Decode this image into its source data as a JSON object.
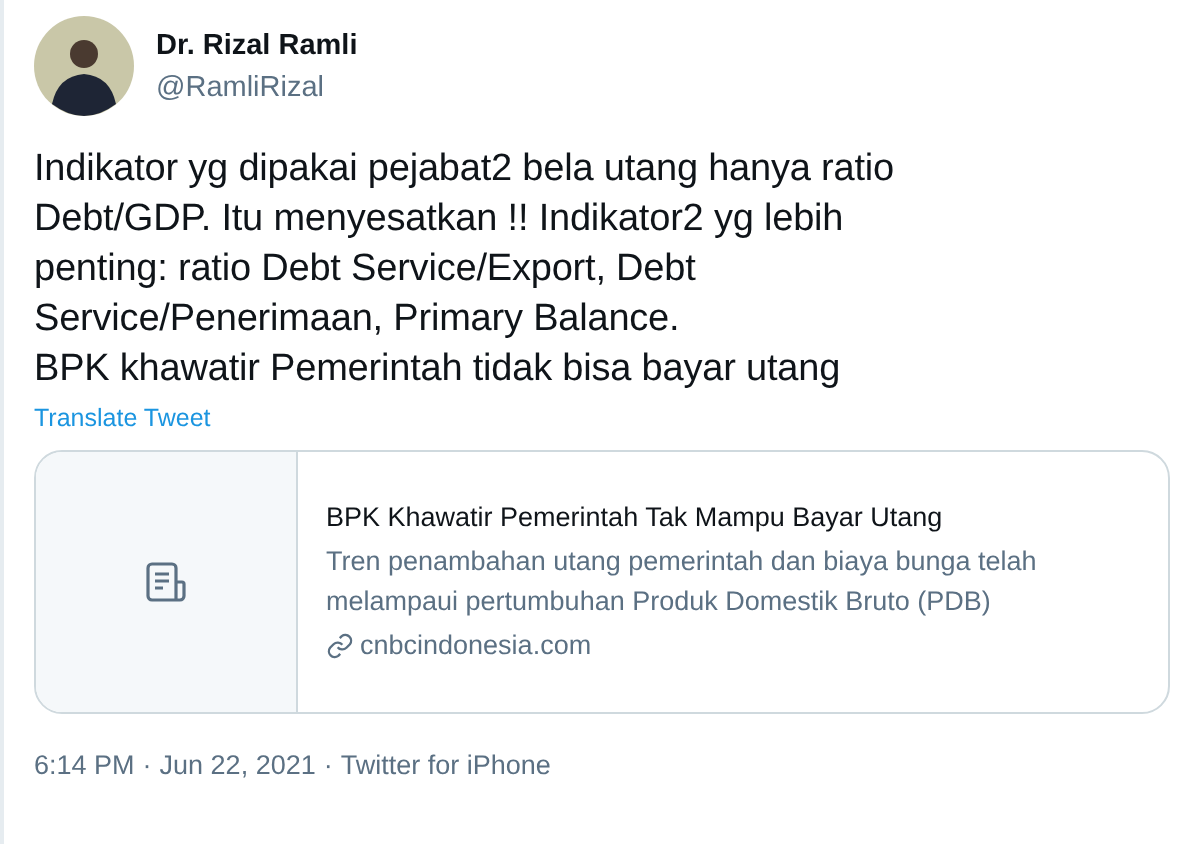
{
  "author": {
    "name": "Dr. Rizal Ramli",
    "handle": "@RamliRizal"
  },
  "body_lines": [
    "Indikator yg dipakai pejabat2 bela utang hanya ratio",
    "Debt/GDP. Itu menyesatkan !! Indikator2 yg lebih",
    "penting: ratio Debt Service/Export, Debt",
    "Service/Penerimaan, Primary Balance.",
    "BPK khawatir Pemerintah tidak bisa bayar utang"
  ],
  "translate_link": "Translate Tweet",
  "link_card": {
    "title": "BPK Khawatir Pemerintah Tak Mampu Bayar Utang",
    "description_lines": [
      "Tren penambahan utang pemerintah dan biaya bunga telah",
      "melampaui pertumbuhan Produk Domestik Bruto (PDB)"
    ],
    "domain": "cnbcindonesia.com"
  },
  "footer": {
    "time": "6:14 PM",
    "date": "Jun 22, 2021",
    "source": "Twitter for iPhone",
    "separators": [
      "·",
      "·"
    ]
  }
}
